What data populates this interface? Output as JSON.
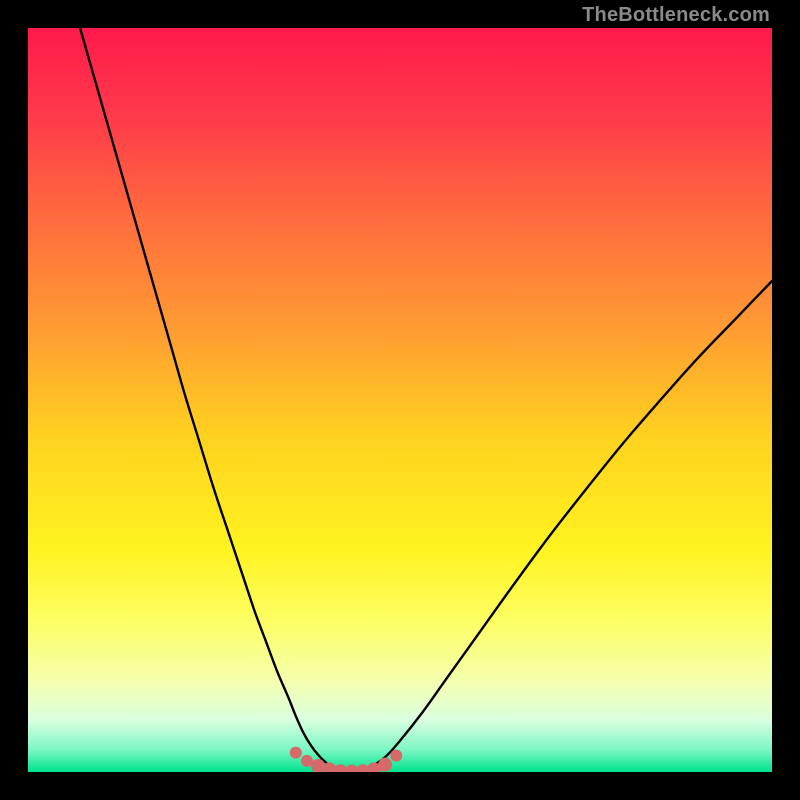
{
  "watermark": "TheBottleneck.com",
  "gradient_stops": [
    {
      "offset": 0.0,
      "color": "#ff1a4b"
    },
    {
      "offset": 0.12,
      "color": "#ff3a4a"
    },
    {
      "offset": 0.25,
      "color": "#ff6a3f"
    },
    {
      "offset": 0.4,
      "color": "#ff9a33"
    },
    {
      "offset": 0.55,
      "color": "#ffd21f"
    },
    {
      "offset": 0.7,
      "color": "#fff320"
    },
    {
      "offset": 0.8,
      "color": "#fdff66"
    },
    {
      "offset": 0.88,
      "color": "#f4ffb0"
    },
    {
      "offset": 0.93,
      "color": "#d9ffe0"
    },
    {
      "offset": 0.97,
      "color": "#7cf7c3"
    },
    {
      "offset": 1.0,
      "color": "#00e38c"
    }
  ],
  "chart_data": {
    "type": "line",
    "title": "",
    "xlabel": "",
    "ylabel": "",
    "xlim": [
      0,
      100
    ],
    "ylim": [
      0,
      100
    ],
    "grid": false,
    "series": [
      {
        "name": "bottleneck-curve",
        "x": [
          7,
          9,
          11,
          13,
          15,
          17,
          19,
          21,
          23,
          25,
          27,
          29,
          30.5,
          32,
          33.5,
          35,
          36,
          37,
          38,
          39,
          40,
          41,
          42,
          43,
          44,
          45,
          46,
          48,
          50,
          53,
          56,
          60,
          65,
          70,
          75,
          80,
          85,
          90,
          95,
          100
        ],
        "y": [
          100,
          93,
          86,
          79,
          72,
          65,
          58,
          51,
          44.5,
          38,
          32,
          26,
          21.5,
          17.5,
          13.5,
          10,
          7.5,
          5.3,
          3.6,
          2.3,
          1.3,
          0.6,
          0.15,
          0.0,
          0.0,
          0.15,
          0.6,
          2.0,
          4.2,
          8.0,
          12.2,
          17.8,
          24.8,
          31.6,
          38.0,
          44.2,
          50.0,
          55.6,
          60.8,
          66.0
        ]
      }
    ],
    "markers": [
      {
        "name": "trough-dot",
        "x": 36.0,
        "y": 2.6,
        "r": 6,
        "color": "#d66a6a"
      },
      {
        "name": "trough-dot",
        "x": 37.5,
        "y": 1.5,
        "r": 6,
        "color": "#d66a6a"
      },
      {
        "name": "trough-dot",
        "x": 39.0,
        "y": 0.8,
        "r": 7,
        "color": "#d66a6a"
      },
      {
        "name": "trough-dot",
        "x": 40.5,
        "y": 0.35,
        "r": 7,
        "color": "#d66a6a"
      },
      {
        "name": "trough-dot",
        "x": 42.0,
        "y": 0.1,
        "r": 7,
        "color": "#d66a6a"
      },
      {
        "name": "trough-dot",
        "x": 43.5,
        "y": 0.05,
        "r": 7,
        "color": "#d66a6a"
      },
      {
        "name": "trough-dot",
        "x": 45.0,
        "y": 0.1,
        "r": 7,
        "color": "#d66a6a"
      },
      {
        "name": "trough-dot",
        "x": 46.5,
        "y": 0.35,
        "r": 7,
        "color": "#d66a6a"
      },
      {
        "name": "trough-dot",
        "x": 48.0,
        "y": 1.0,
        "r": 7,
        "color": "#d66a6a"
      },
      {
        "name": "trough-dot",
        "x": 49.5,
        "y": 2.2,
        "r": 6,
        "color": "#d66a6a"
      }
    ]
  }
}
